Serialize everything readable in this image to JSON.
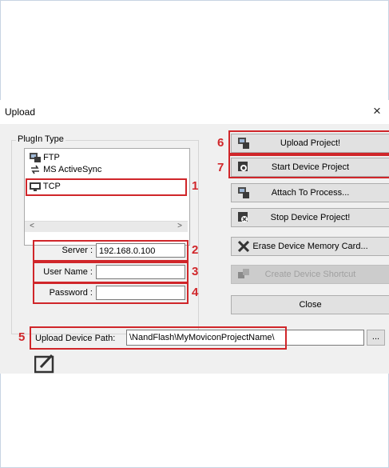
{
  "dialog": {
    "title": "Upload",
    "close_glyph": "×"
  },
  "plugin_group": {
    "label": "PlugIn Type",
    "items": [
      {
        "label": "FTP",
        "icon": "ftp-icon"
      },
      {
        "label": "MS ActiveSync",
        "icon": "activesync-icon"
      },
      {
        "label": "TCP",
        "icon": "tcp-icon"
      }
    ],
    "scroll_left": "<",
    "scroll_right": ">"
  },
  "fields": {
    "server_label": "Server :",
    "server_value": "192.168.0.100",
    "username_label": "User Name :",
    "username_value": "",
    "password_label": "Password :",
    "password_value": ""
  },
  "buttons": {
    "upload_project": "Upload Project!",
    "start_device_project": "Start Device Project",
    "attach_to_process": "Attach To Process...",
    "stop_device_project": "Stop Device Project!",
    "erase_memory_card": "Erase Device Memory Card...",
    "create_shortcut": "Create Device Shortcut",
    "close": "Close",
    "browse": "..."
  },
  "upload_path": {
    "label": "Upload Device Path:",
    "value": "\\NandFlash\\MyMoviconProjectName\\"
  },
  "callouts": [
    "1",
    "2",
    "3",
    "4",
    "5",
    "6",
    "7"
  ],
  "colors": {
    "callout_red": "#d0262a",
    "dialog_bg": "#f0f0f0",
    "button_bg": "#e1e1e1"
  }
}
